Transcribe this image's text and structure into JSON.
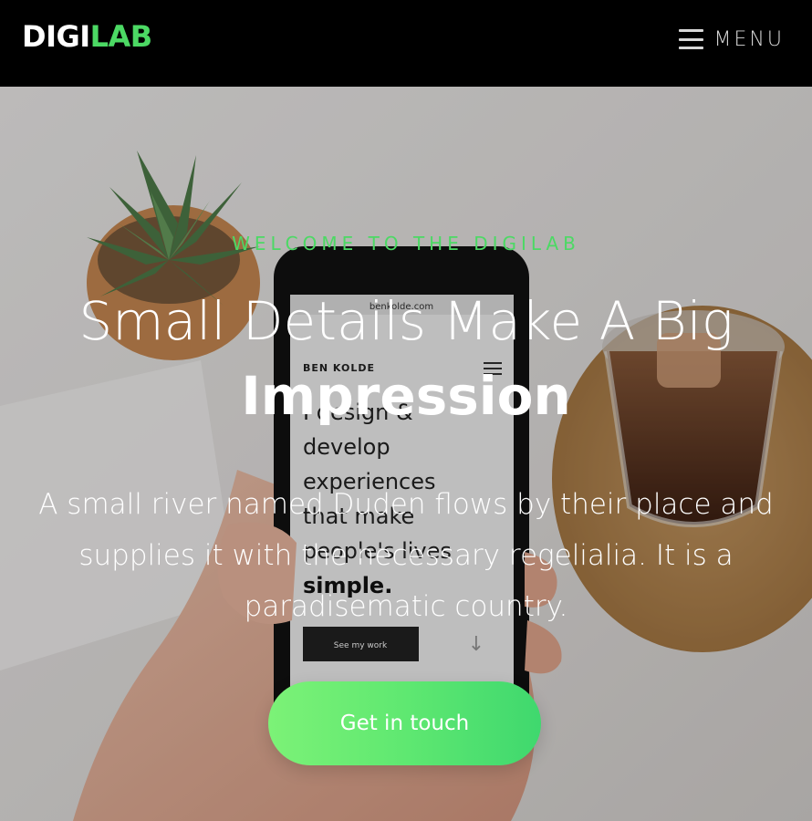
{
  "navbar": {
    "brand_part1": "DIGI",
    "brand_part2": "LAB",
    "menu_label": "MENU",
    "menu_icon": "hamburger-icon",
    "accent_color": "#4cd964",
    "background_color": "#000000"
  },
  "hero": {
    "subheading": "WELCOME TO THE DIGILAB",
    "headline_line1": "Small Details Make A Big",
    "headline_line2": "Impression",
    "description": "A small river named Duden flows by their place and supplies it with the necessary regelialia. It is a paradisematic country.",
    "cta_label": "Get in touch",
    "cta_gradient": [
      "#7cf277",
      "#3fd86e"
    ],
    "background_image": "phone-desk-photo",
    "phone_screen": {
      "url_text": "benkolde.com",
      "logo_text": "BEN KOLDE",
      "body_lines": [
        "I design &",
        "develop",
        "experiences",
        "that make",
        "people's lives",
        "simple."
      ],
      "button_label": "See my work"
    }
  }
}
